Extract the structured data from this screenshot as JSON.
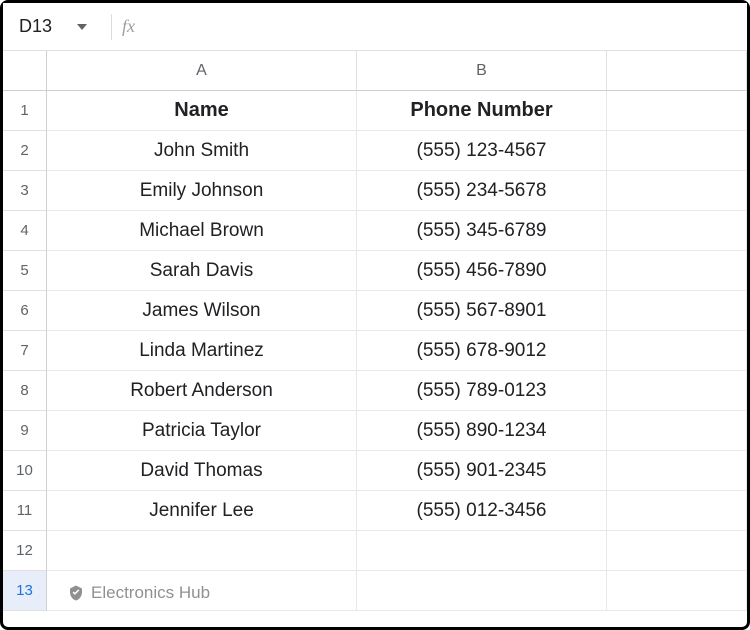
{
  "formula_bar": {
    "cell_reference": "D13",
    "fx_label": "fx",
    "formula_value": ""
  },
  "columns": [
    "A",
    "B",
    ""
  ],
  "rows": [
    "1",
    "2",
    "3",
    "4",
    "5",
    "6",
    "7",
    "8",
    "9",
    "10",
    "11",
    "12",
    "13"
  ],
  "selected_row": "13",
  "headers": {
    "A": "Name",
    "B": "Phone Number"
  },
  "grid": [
    {
      "A": "John Smith",
      "B": "(555) 123-4567"
    },
    {
      "A": "Emily Johnson",
      "B": "(555) 234-5678"
    },
    {
      "A": "Michael Brown",
      "B": "(555) 345-6789"
    },
    {
      "A": "Sarah Davis",
      "B": "(555) 456-7890"
    },
    {
      "A": "James Wilson",
      "B": "(555) 567-8901"
    },
    {
      "A": "Linda Martinez",
      "B": "(555) 678-9012"
    },
    {
      "A": "Robert Anderson",
      "B": "(555) 789-0123"
    },
    {
      "A": "Patricia Taylor",
      "B": "(555) 890-1234"
    },
    {
      "A": "David Thomas",
      "B": "(555) 901-2345"
    },
    {
      "A": "Jennifer Lee",
      "B": "(555) 012-3456"
    }
  ],
  "watermark": "Electronics Hub"
}
